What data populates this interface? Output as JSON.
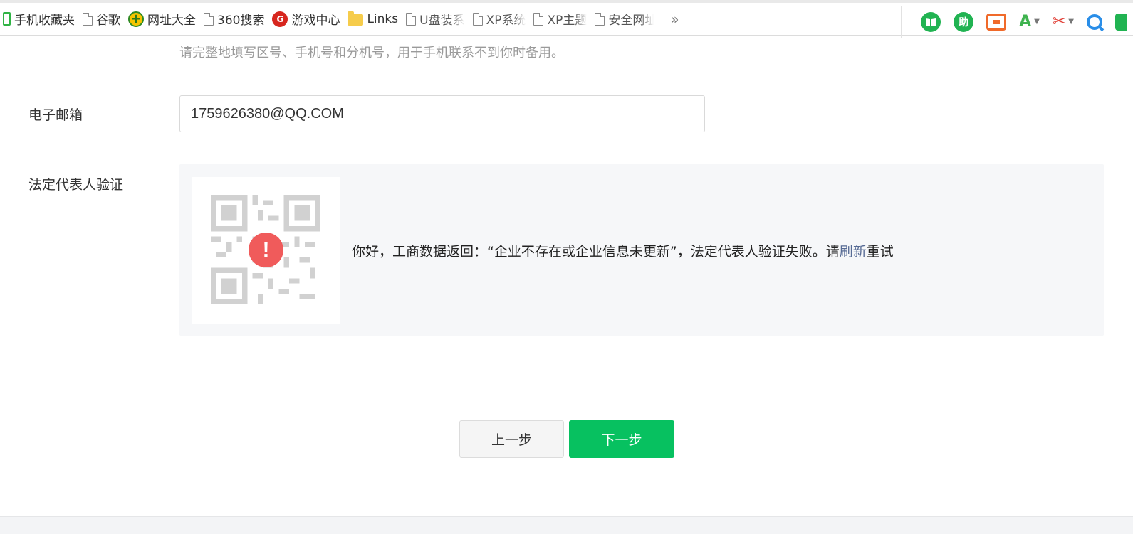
{
  "bookmarks": [
    {
      "label": "手机收藏夹",
      "icon": "phone-icon"
    },
    {
      "label": "谷歌",
      "icon": "page-icon"
    },
    {
      "label": "网址大全",
      "icon": "plus-globe-icon"
    },
    {
      "label": "360搜索",
      "icon": "page-icon"
    },
    {
      "label": "游戏中心",
      "icon": "game-icon"
    },
    {
      "label": "Links",
      "icon": "folder-icon"
    },
    {
      "label": "U盘装系",
      "icon": "page-icon"
    },
    {
      "label": "XP系统",
      "icon": "page-icon"
    },
    {
      "label": "XP主题",
      "icon": "page-icon"
    },
    {
      "label": "安全网址",
      "icon": "page-icon"
    }
  ],
  "more_bookmarks": "»",
  "toolbar_icons": {
    "help_label": "助",
    "translate_label": "A",
    "colors": {
      "green": "#21b352",
      "orange": "#f06a2a",
      "red": "#e2463d",
      "blue": "#2a8ee8"
    }
  },
  "form": {
    "phone_hint": "请完整地填写区号、手机号和分机号，用于手机联系不到你时备用。",
    "email": {
      "label": "电子邮箱",
      "value": "1759626380@QQ.COM"
    },
    "legal_rep": {
      "label": "法定代表人验证",
      "error_symbol": "!",
      "message_before": "你好，工商数据返回：“企业不存在或企业信息未更新”，法定代表人验证失败。请",
      "refresh_link": "刷新",
      "message_after": "重试"
    }
  },
  "buttons": {
    "prev": "上一步",
    "next": "下一步"
  },
  "colors": {
    "primary": "#07c160",
    "error": "#f05b5b",
    "link": "#576b95"
  }
}
